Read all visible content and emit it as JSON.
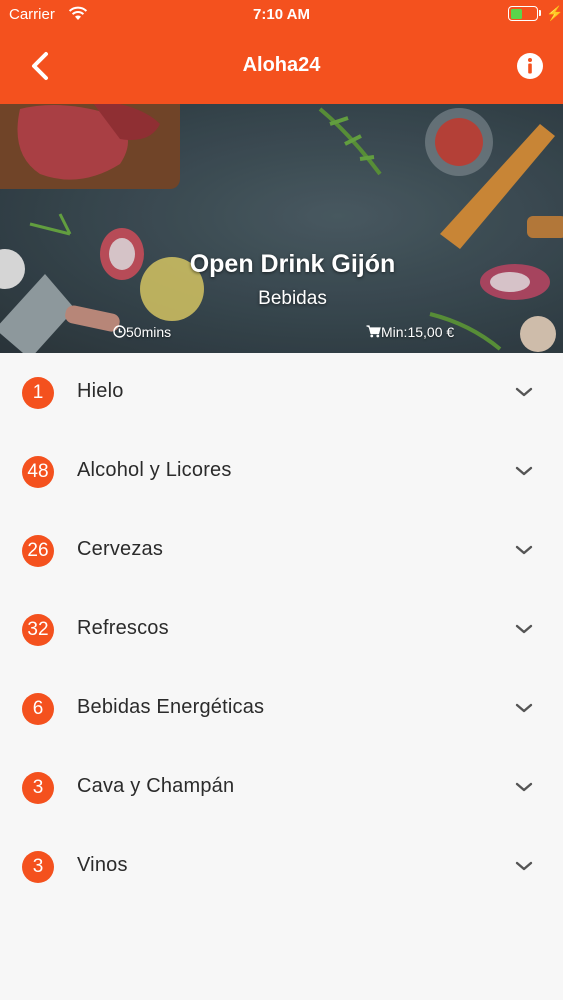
{
  "status_bar": {
    "carrier": "Carrier",
    "time": "7:10 AM",
    "battery_level": 0.45
  },
  "nav": {
    "title": "Aloha24",
    "back_icon": "chevron-left-icon",
    "info_icon": "info-icon"
  },
  "colors": {
    "accent": "#f4511e",
    "battery": "#5ad44b"
  },
  "shop": {
    "name": "Open Drink Gijón",
    "category": "Bebidas",
    "delivery_time": "50mins",
    "minimum_order": "Min:15,00 €"
  },
  "categories": [
    {
      "count": "1",
      "label": "Hielo"
    },
    {
      "count": "48",
      "label": "Alcohol y Licores"
    },
    {
      "count": "26",
      "label": "Cervezas"
    },
    {
      "count": "32",
      "label": "Refrescos"
    },
    {
      "count": "6",
      "label": "Bebidas Energéticas"
    },
    {
      "count": "3",
      "label": "Cava y Champán"
    },
    {
      "count": "3",
      "label": "Vinos"
    }
  ]
}
